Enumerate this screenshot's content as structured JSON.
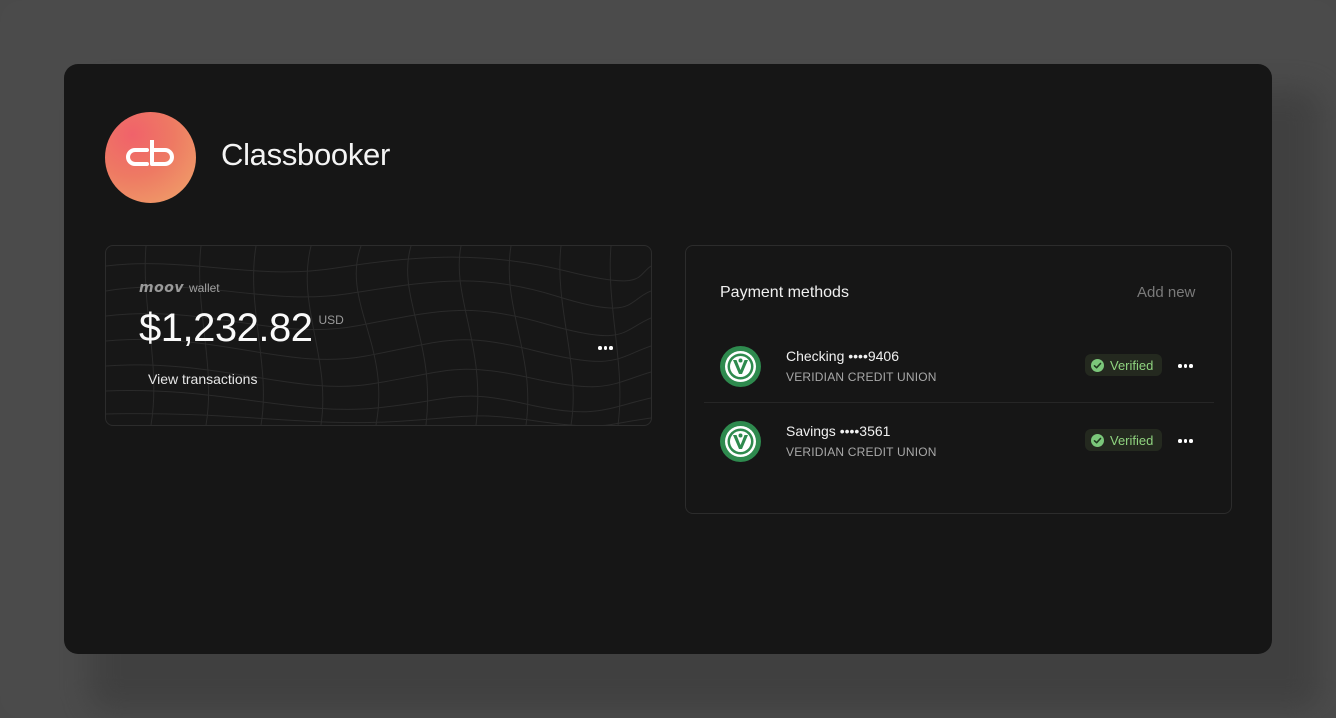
{
  "account": {
    "logo_text": "cb",
    "name": "Classbooker"
  },
  "wallet": {
    "provider_logo": "moov",
    "label": "wallet",
    "balance": "$1,232.82",
    "currency": "USD",
    "view_transactions": "View transactions",
    "more_icon": "more-horizontal-icon"
  },
  "payment_methods": {
    "title": "Payment methods",
    "add_new": "Add new",
    "items": [
      {
        "name": "Checking ••••9406",
        "bank": "VERIDIAN CREDIT UNION",
        "status": "Verified",
        "icon": "veridian-logo-icon"
      },
      {
        "name": "Savings ••••3561",
        "bank": "VERIDIAN CREDIT UNION",
        "status": "Verified",
        "icon": "veridian-logo-icon"
      }
    ]
  },
  "colors": {
    "background": "#4a4a4a",
    "panel": "#161616",
    "verified_green": "#8fd37f",
    "logo_gradient_start": "#f0626a",
    "logo_gradient_end": "#f0a66a",
    "bank_green": "#2e8a4e"
  }
}
